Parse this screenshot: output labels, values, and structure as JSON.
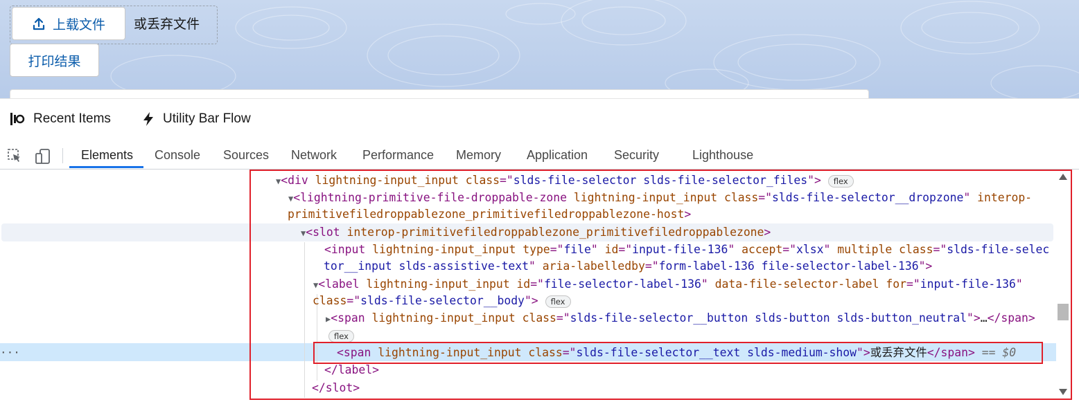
{
  "page": {
    "upload_button": "上载文件",
    "drop_text": "或丢弃文件",
    "print_button": "打印结果"
  },
  "utility_bar": {
    "recent_items": "Recent Items",
    "flow": "Utility Bar Flow"
  },
  "devtools": {
    "tabs": [
      "Elements",
      "Console",
      "Sources",
      "Network",
      "Performance",
      "Memory",
      "Application",
      "Security",
      "Lighthouse"
    ],
    "active_tab": "Elements",
    "flex_badge": "flex",
    "selected_suffix": "== $0",
    "code": {
      "l1_tag": "div",
      "l1_attr": "lightning-input_input",
      "l1_class_name": "class",
      "l1_class_val": "slds-file-selector slds-file-selector_files",
      "l2_tag": "lightning-primitive-file-droppable-zone",
      "l2_attr": "lightning-input_input",
      "l2_class_name": "class",
      "l2_class_val": "slds-file-selector__dropzone",
      "l2_attr2a": "interop-",
      "l2_attr2b": "primitivefiledroppablezone_primitivefiledroppablezone-host",
      "l3_tag": "slot",
      "l3_attr": "interop-primitivefiledroppablezone_primitivefiledroppablezone",
      "l4_tag": "input",
      "l4_attr": "lightning-input_input",
      "l4_type_name": "type",
      "l4_type_val": "file",
      "l4_id_name": "id",
      "l4_id_val": "input-file-136",
      "l4_accept_name": "accept",
      "l4_accept_val": "xlsx",
      "l4_multiple": "multiple",
      "l4_class_name": "class",
      "l4_class_val_a": "slds-file-selec",
      "l4_class_val_b": "tor__input slds-assistive-text",
      "l4_aria_name": "aria-labelledby",
      "l4_aria_val": "form-label-136 file-selector-label-136",
      "l5_tag": "label",
      "l5_attr": "lightning-input_input",
      "l5_id_name": "id",
      "l5_id_val": "file-selector-label-136",
      "l5_data": "data-file-selector-label",
      "l5_for_name": "for",
      "l5_for_val": "input-file-136",
      "l5_class_name": "class",
      "l5_class_val": "slds-file-selector__body",
      "l6_tag": "span",
      "l6_attr": "lightning-input_input",
      "l6_class_name": "class",
      "l6_class_val": "slds-file-selector__button slds-button slds-button_neutral",
      "l6_ellipsis": "…",
      "l7_tag": "span",
      "l7_attr": "lightning-input_input",
      "l7_class_name": "class",
      "l7_class_val": "slds-file-selector__text slds-medium-show",
      "l7_text": "或丢弃文件",
      "close_label": "label",
      "close_slot": "slot"
    }
  },
  "colors": {
    "brand": "#0b5cab",
    "highlight_box": "#e0202a",
    "tab_active": "#1a73e8"
  }
}
